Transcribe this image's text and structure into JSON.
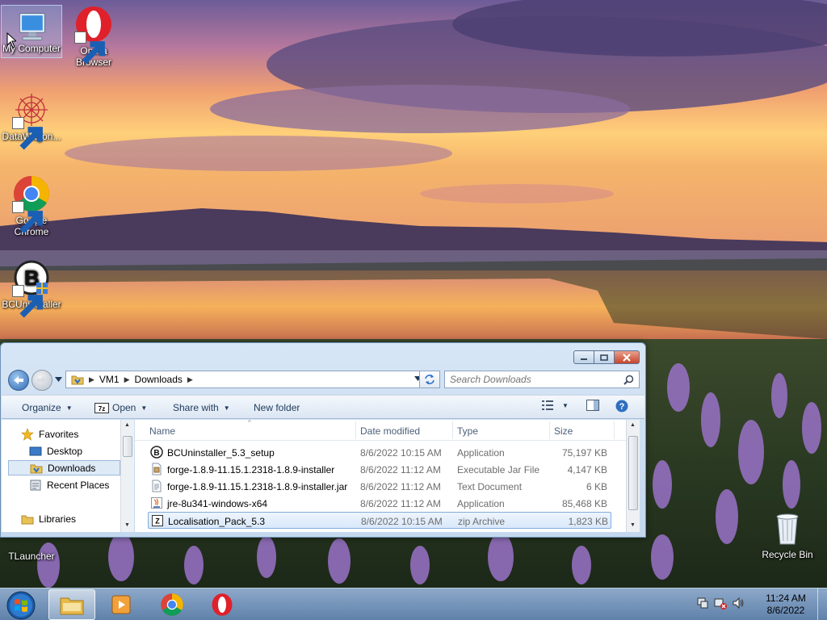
{
  "desktop": {
    "icons": [
      {
        "label": "My Computer",
        "icon": "computer-icon"
      },
      {
        "label": "Opera Browser",
        "icon": "opera-icon"
      },
      {
        "label": "DataWagon...",
        "icon": "datawagon-icon"
      },
      {
        "label": "Google Chrome",
        "icon": "chrome-icon"
      },
      {
        "label": "BCUninstaller",
        "icon": "bcuninstaller-icon"
      },
      {
        "label": "TLauncher",
        "icon": "tlauncher-icon"
      },
      {
        "label": "Recycle Bin",
        "icon": "recycle-bin-icon"
      }
    ]
  },
  "explorer": {
    "breadcrumb": [
      "VM1",
      "Downloads"
    ],
    "search_placeholder": "Search Downloads",
    "toolbar": {
      "organize": "Organize",
      "open": "Open",
      "share_with": "Share with",
      "new_folder": "New folder"
    },
    "nav": {
      "favorites": "Favorites",
      "items": [
        "Desktop",
        "Downloads",
        "Recent Places"
      ],
      "libraries": "Libraries"
    },
    "columns": [
      "Name",
      "Date modified",
      "Type",
      "Size"
    ],
    "files": [
      {
        "name": "BCUninstaller_5.3_setup",
        "date": "8/6/2022 10:15 AM",
        "type": "Application",
        "size": "75,197 KB",
        "icon": "bcuninstaller-file-icon"
      },
      {
        "name": "forge-1.8.9-11.15.1.2318-1.8.9-installer",
        "date": "8/6/2022 11:12 AM",
        "type": "Executable Jar File",
        "size": "4,147 KB",
        "icon": "jar-file-icon"
      },
      {
        "name": "forge-1.8.9-11.15.1.2318-1.8.9-installer.jar",
        "date": "8/6/2022 11:12 AM",
        "type": "Text Document",
        "size": "6 KB",
        "icon": "text-file-icon"
      },
      {
        "name": "jre-8u341-windows-x64",
        "date": "8/6/2022 11:12 AM",
        "type": "Application",
        "size": "85,468 KB",
        "icon": "java-installer-icon"
      },
      {
        "name": "Localisation_Pack_5.3",
        "date": "8/6/2022 10:15 AM",
        "type": "zip Archive",
        "size": "1,823 KB",
        "icon": "zip-archive-icon"
      }
    ]
  },
  "taskbar": {
    "time": "11:24 AM",
    "date": "8/6/2022"
  }
}
